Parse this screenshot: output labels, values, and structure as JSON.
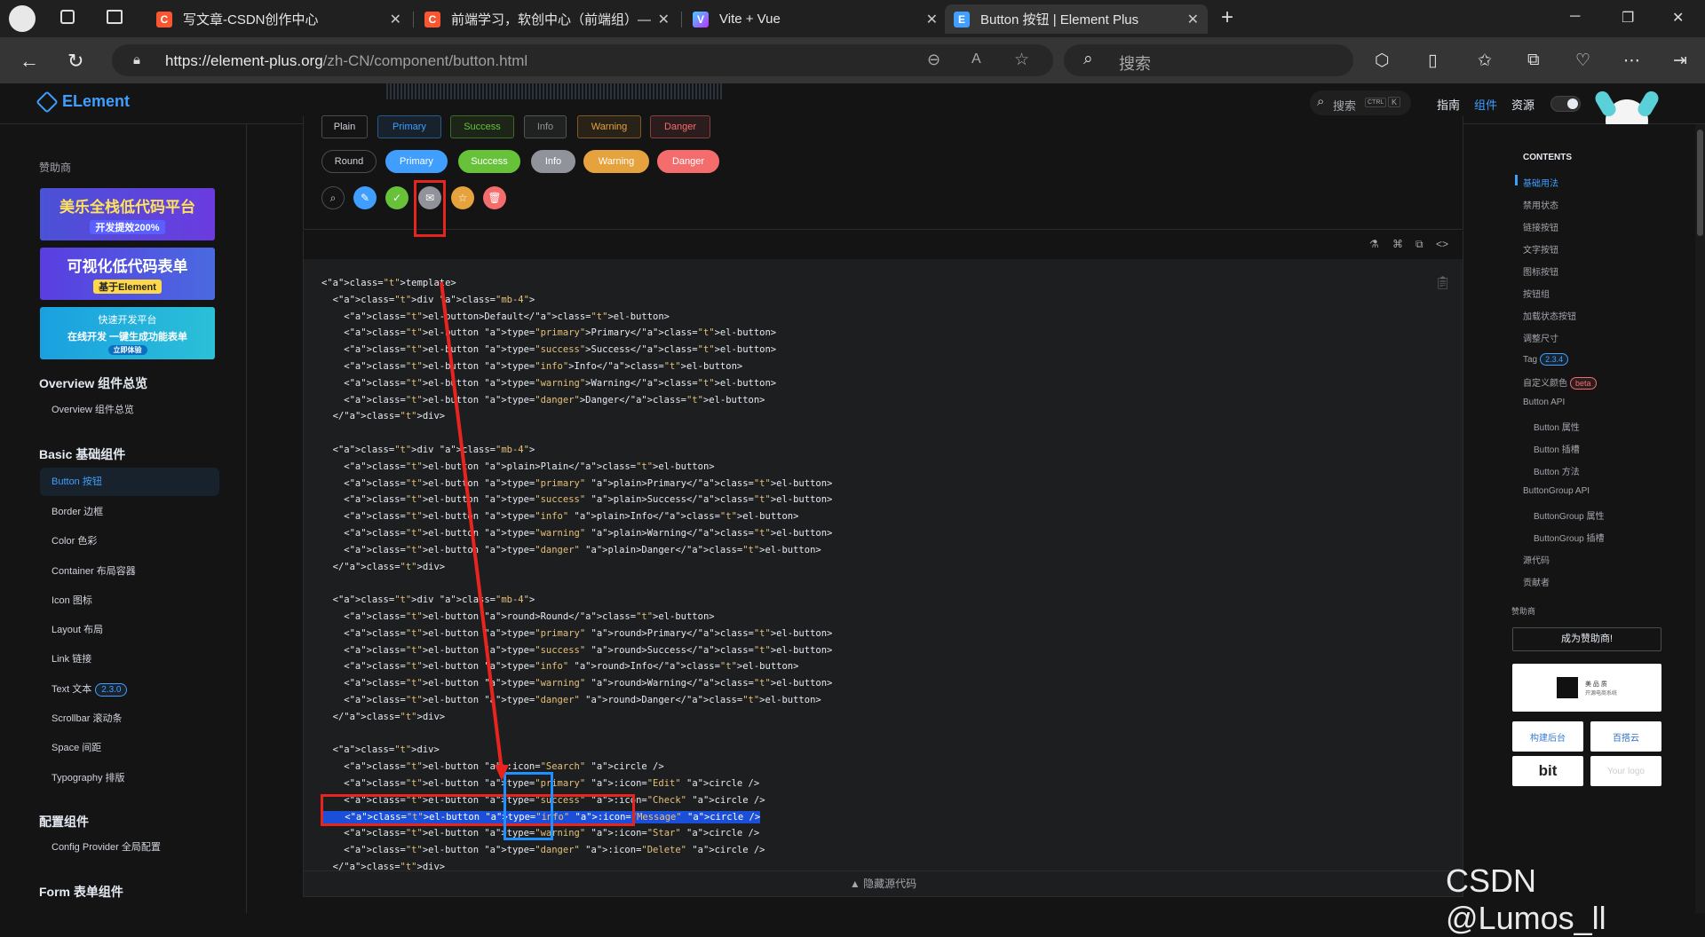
{
  "tabs": [
    {
      "title": "写文章-CSDN创作中心",
      "icon": "csdn-icon",
      "color": "#fc5531"
    },
    {
      "title": "前端学习，软创中心（前端组）— ",
      "icon": "csdn-icon",
      "color": "#fc5531"
    },
    {
      "title": "Vite + Vue",
      "icon": "vite-icon",
      "color": "#a259ff"
    },
    {
      "title": "Button 按钮 | Element Plus",
      "icon": "element-icon",
      "color": "#409eff"
    }
  ],
  "address": {
    "host": "https://element-plus.org",
    "path": "/zh-CN/component/button.html"
  },
  "browser_search": {
    "placeholder": "搜索"
  },
  "header": {
    "logo": "ELement",
    "search_label": "搜索",
    "search_keys": [
      "CTRL",
      "K"
    ],
    "nav": [
      "指南",
      "组件",
      "资源"
    ]
  },
  "sidebar": {
    "sponsor_label": "赞助商",
    "ads": [
      {
        "line1": "美乐全栈低代码平台",
        "line2": "开发提效200%"
      },
      {
        "line1": "可视化低代码表单",
        "line2": "基于Element"
      },
      {
        "line1": "快速开发平台",
        "line2": "在线开发 一键生成功能表单",
        "line3": "立即体验"
      }
    ],
    "groups": [
      {
        "title": "Overview 组件总览",
        "items": [
          {
            "label": "Overview 组件总览"
          }
        ]
      },
      {
        "title": "Basic 基础组件",
        "items": [
          {
            "label": "Button 按钮",
            "active": true
          },
          {
            "label": "Border 边框"
          },
          {
            "label": "Color 色彩"
          },
          {
            "label": "Container 布局容器"
          },
          {
            "label": "Icon 图标"
          },
          {
            "label": "Layout 布局"
          },
          {
            "label": "Link 链接"
          },
          {
            "label": "Text 文本",
            "badge": "2.3.0"
          },
          {
            "label": "Scrollbar 滚动条"
          },
          {
            "label": "Space 间距"
          },
          {
            "label": "Typography 排版"
          }
        ]
      },
      {
        "title": "配置组件",
        "items": [
          {
            "label": "Config Provider 全局配置"
          }
        ]
      },
      {
        "title": "Form 表单组件",
        "items": []
      }
    ]
  },
  "demo": {
    "plain_row": [
      "Plain",
      "Primary",
      "Success",
      "Info",
      "Warning",
      "Danger"
    ],
    "round_row": [
      "Round",
      "Primary",
      "Success",
      "Info",
      "Warning",
      "Danger"
    ],
    "circle_icons": [
      "search-icon",
      "edit-icon",
      "check-icon",
      "message-icon",
      "star-icon",
      "delete-icon"
    ]
  },
  "code_lines": [
    "<template>",
    "  <div class=\"mb-4\">",
    "    <el-button>Default</el-button>",
    "    <el-button type=\"primary\">Primary</el-button>",
    "    <el-button type=\"success\">Success</el-button>",
    "    <el-button type=\"info\">Info</el-button>",
    "    <el-button type=\"warning\">Warning</el-button>",
    "    <el-button type=\"danger\">Danger</el-button>",
    "  </div>",
    "",
    "  <div class=\"mb-4\">",
    "    <el-button plain>Plain</el-button>",
    "    <el-button type=\"primary\" plain>Primary</el-button>",
    "    <el-button type=\"success\" plain>Success</el-button>",
    "    <el-button type=\"info\" plain>Info</el-button>",
    "    <el-button type=\"warning\" plain>Warning</el-button>",
    "    <el-button type=\"danger\" plain>Danger</el-button>",
    "  </div>",
    "",
    "  <div class=\"mb-4\">",
    "    <el-button round>Round</el-button>",
    "    <el-button type=\"primary\" round>Primary</el-button>",
    "    <el-button type=\"success\" round>Success</el-button>",
    "    <el-button type=\"info\" round>Info</el-button>",
    "    <el-button type=\"warning\" round>Warning</el-button>",
    "    <el-button type=\"danger\" round>Danger</el-button>",
    "  </div>",
    "",
    "  <div>",
    "    <el-button :icon=\"Search\" circle />",
    "    <el-button type=\"primary\" :icon=\"Edit\" circle />",
    "    <el-button type=\"success\" :icon=\"Check\" circle />",
    "    <el-button type=\"info\" :icon=\"Message\" circle />",
    "    <el-button type=\"warning\" :icon=\"Star\" circle />",
    "    <el-button type=\"danger\" :icon=\"Delete\" circle />",
    "  </div>"
  ],
  "hide_code_label": "隐藏源代码",
  "toc": {
    "title": "CONTENTS",
    "items": [
      {
        "label": "基础用法",
        "active": true,
        "indent": 0
      },
      {
        "label": "禁用状态",
        "indent": 0
      },
      {
        "label": "链接按钮",
        "indent": 0
      },
      {
        "label": "文字按钮",
        "indent": 0
      },
      {
        "label": "图标按钮",
        "indent": 0
      },
      {
        "label": "按钮组",
        "indent": 0
      },
      {
        "label": "加载状态按钮",
        "indent": 0
      },
      {
        "label": "调整尺寸",
        "indent": 0
      },
      {
        "label": "Tag",
        "badge": "2.3.4",
        "indent": 0
      },
      {
        "label": "自定义颜色",
        "badge": "beta",
        "indent": 0
      },
      {
        "label": "Button API",
        "indent": 0
      },
      {
        "label": "Button 属性",
        "indent": 1
      },
      {
        "label": "Button 插槽",
        "indent": 1
      },
      {
        "label": "Button 方法",
        "indent": 1
      },
      {
        "label": "ButtonGroup API",
        "indent": 0
      },
      {
        "label": "ButtonGroup 属性",
        "indent": 1
      },
      {
        "label": "ButtonGroup 插槽",
        "indent": 1
      },
      {
        "label": "源代码",
        "indent": 0
      },
      {
        "label": "贡献者",
        "indent": 0
      }
    ],
    "sponsor_label": "赞助商",
    "become_sponsor": "成为赞助商!",
    "sponsor_logo_title": "美 品 质",
    "sponsor_logo_sub": "开源电商系统",
    "logos": [
      "构建后台",
      "百搭云",
      "bit",
      "Your logo"
    ]
  },
  "watermark": "CSDN @Lumos_ll",
  "colors": {
    "primary": "#409eff",
    "success": "#67c23a",
    "info": "#909399",
    "warning": "#e6a23c",
    "danger": "#f56c6c"
  }
}
